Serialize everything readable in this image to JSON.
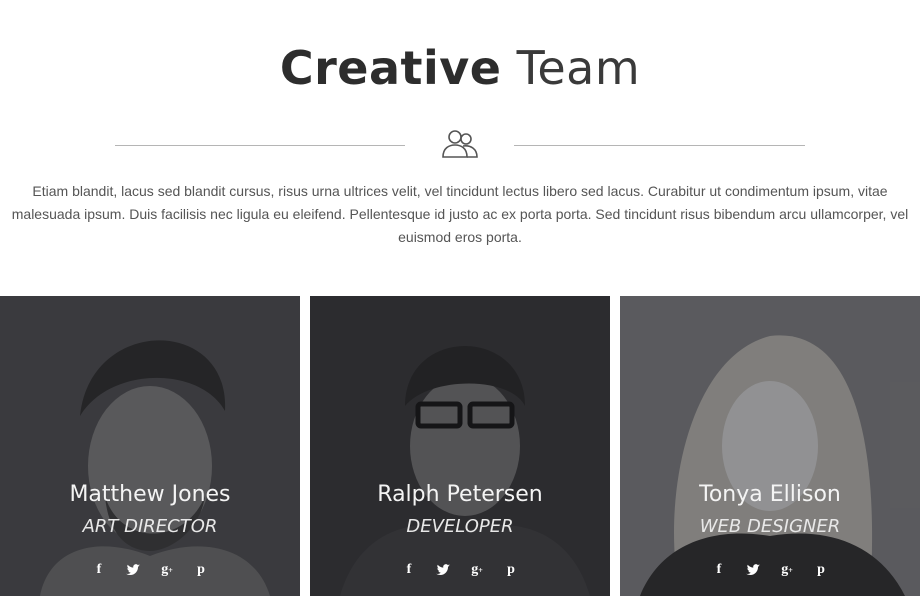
{
  "section": {
    "title_bold": "Creative",
    "title_light": "Team",
    "intro": "Etiam blandit, lacus sed blandit cursus, risus urna ultrices velit, vel tincidunt lectus libero sed lacus. Curabitur ut condimentum ipsum, vitae malesuada ipsum. Duis facilisis nec ligula eu eleifend. Pellentesque id justo ac ex porta porta. Sed tincidunt risus bibendum arcu ullamcorper, vel euismod eros porta.",
    "icon": "team-users-icon"
  },
  "members": [
    {
      "name": "Matthew Jones",
      "role": "ART DIRECTOR"
    },
    {
      "name": "Ralph Petersen",
      "role": "DEVELOPER"
    },
    {
      "name": "Tonya Ellison",
      "role": "WEB DESIGNER"
    }
  ],
  "social_icons": [
    "facebook-icon",
    "twitter-icon",
    "google-plus-icon",
    "pinterest-icon"
  ],
  "colors": {
    "title": "#2d2d2d",
    "text": "#555555",
    "divider": "#b5b5b5",
    "overlay": "#1e1e22"
  }
}
